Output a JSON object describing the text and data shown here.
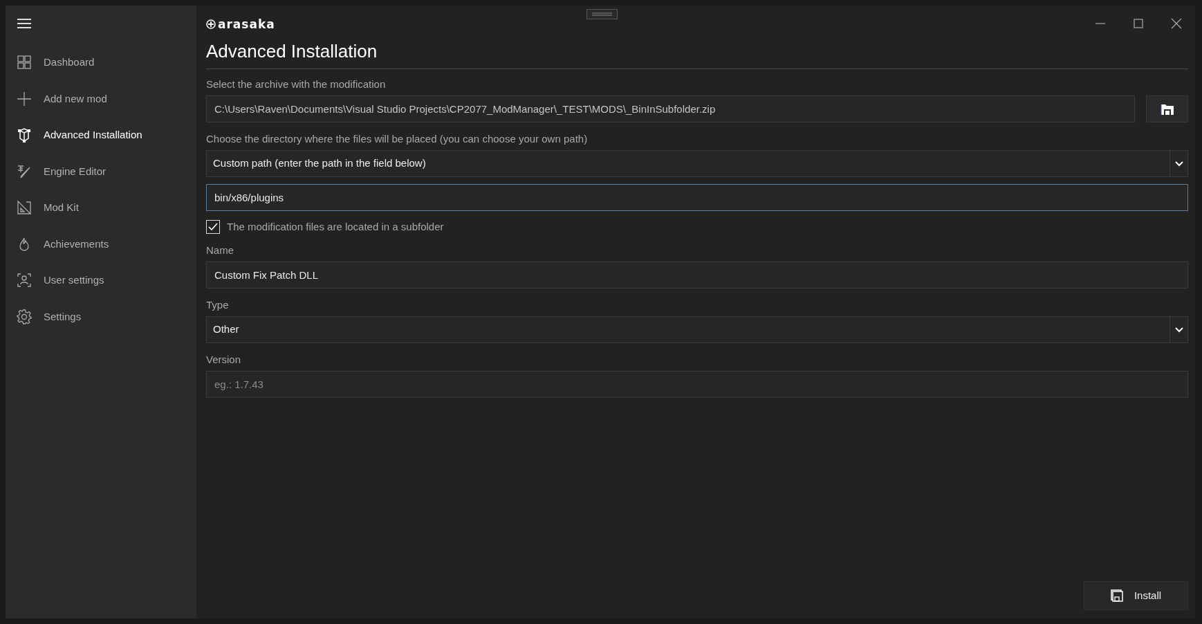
{
  "sidebar": {
    "items": [
      {
        "kind": "dashboard",
        "label": "Dashboard",
        "selected": false
      },
      {
        "kind": "add",
        "label": "Add new mod",
        "selected": false
      },
      {
        "kind": "advanced",
        "label": "Advanced Installation",
        "selected": true
      },
      {
        "kind": "engine",
        "label": "Engine Editor",
        "selected": false
      },
      {
        "kind": "modkit",
        "label": "Mod Kit",
        "selected": false
      },
      {
        "kind": "achievements",
        "label": "Achievements",
        "selected": false
      },
      {
        "kind": "user",
        "label": "User settings",
        "selected": false
      },
      {
        "kind": "settings",
        "label": "Settings",
        "selected": false
      }
    ]
  },
  "logo": "arasaka",
  "title": "Advanced Installation",
  "fields": [
    {
      "kind": "file",
      "label": "Select the archive with the modification",
      "value": "C:\\Users\\Raven\\Documents\\Visual Studio Projects\\CP2077_ModManager\\_TEST\\MODS\\_BinInSubfolder.zip"
    },
    {
      "kind": "select",
      "label": "Choose the directory where the files will be placed (you can choose your own path)",
      "value": "Custom path (enter the path in the field below)"
    },
    {
      "kind": "text",
      "value": "bin/x86/plugins",
      "focused": true
    },
    {
      "kind": "checkbox",
      "label": "The modification files are located in a subfolder",
      "checked": true
    },
    {
      "kind": "text",
      "label": "Name",
      "value": "Custom Fix Patch DLL",
      "focused": false
    },
    {
      "kind": "select",
      "label": "Type",
      "value": "Other"
    },
    {
      "kind": "text",
      "label": "Version",
      "placeholder": "eg.: 1.7.43",
      "focused": false
    }
  ],
  "install_button": {
    "label": "Install"
  }
}
